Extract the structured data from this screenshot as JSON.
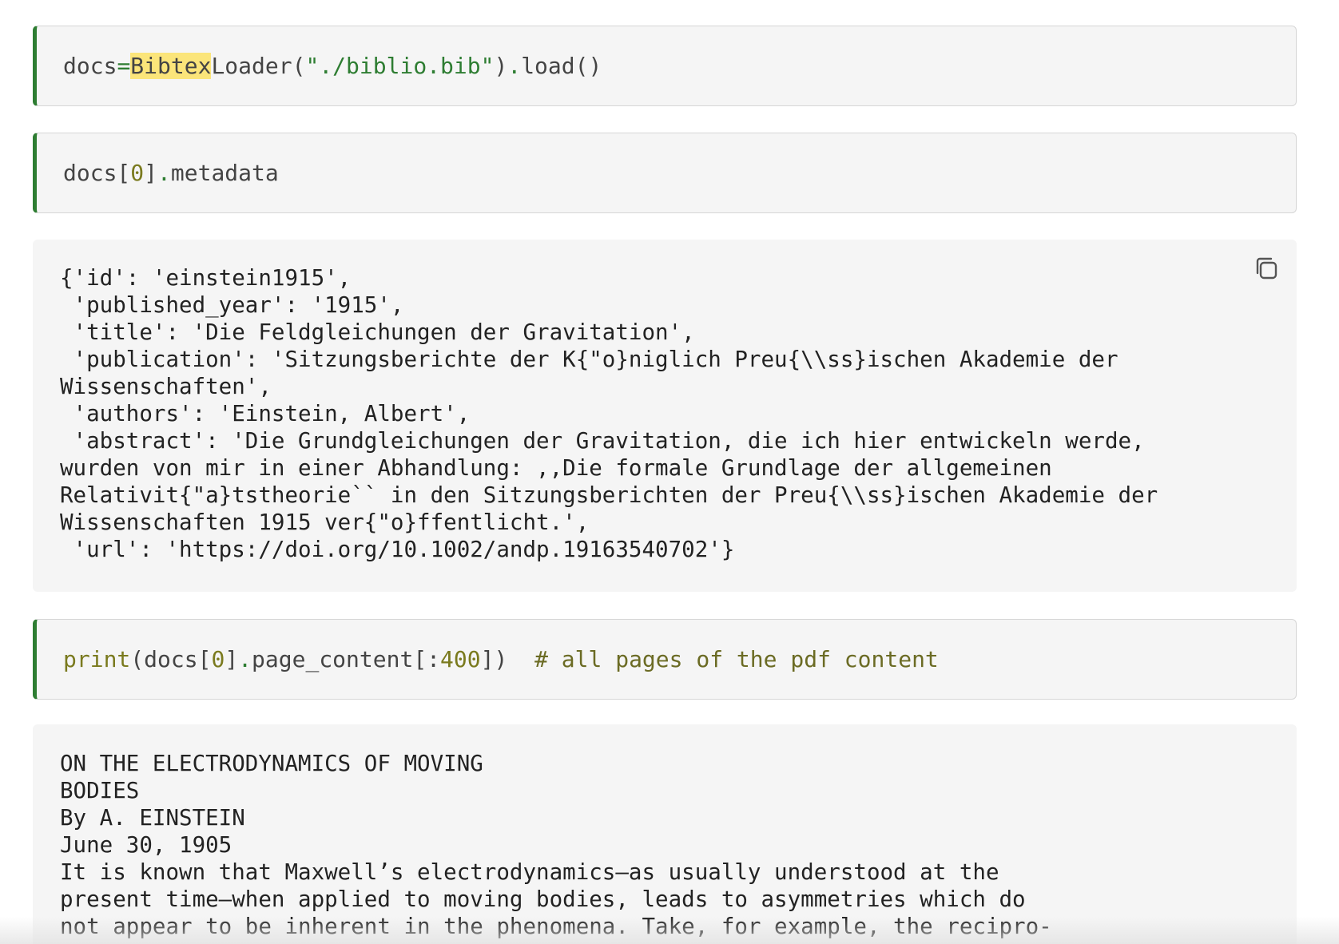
{
  "cells": {
    "cell1": {
      "var": "docs",
      "op": "=",
      "hl": "Bibtex",
      "cls_rest": "Loader(",
      "str": "\"./biblio.bib\"",
      "close": ")",
      "dot": ".",
      "method": "load()"
    },
    "cell2": {
      "var": "docs[",
      "idx": "0",
      "close": "]",
      "dot": ".",
      "attr": "metadata"
    },
    "output1": {
      "lines": [
        "{'id': 'einstein1915',",
        " 'published_year': '1915',",
        " 'title': 'Die Feldgleichungen der Gravitation',",
        " 'publication': 'Sitzungsberichte der K{\"o}niglich Preu{\\\\ss}ischen Akademie der",
        "Wissenschaften',",
        " 'authors': 'Einstein, Albert',",
        " 'abstract': 'Die Grundgleichungen der Gravitation, die ich hier entwickeln werde,",
        "wurden von mir in einer Abhandlung: ,,Die formale Grundlage der allgemeinen",
        "Relativit{\"a}tstheorie`` in den Sitzungsberichten der Preu{\\\\ss}ischen Akademie der",
        "Wissenschaften 1915 ver{\"o}ffentlicht.',",
        " 'url': 'https://doi.org/10.1002/andp.19163540702'}"
      ]
    },
    "cell3": {
      "fn": "print",
      "open": "(docs[",
      "idx": "0",
      "close1": "]",
      "dot": ".",
      "attr": "page_content[:",
      "num": "400",
      "close2": "])",
      "gap": "  ",
      "comment": "# all pages of the pdf content"
    },
    "output2": {
      "lines": [
        "ON THE ELECTRODYNAMICS OF MOVING",
        "BODIES",
        "By A. EINSTEIN",
        "June 30, 1905",
        "It is known that Maxwell’s electrodynamics—as usually understood at the",
        "present time—when applied to moving bodies, leads to asymmetries which do",
        "not appear to be inherent in the phenomena. Take, for example, the recipro-"
      ]
    }
  },
  "icons": {
    "copy": "copy-icon"
  },
  "colors": {
    "accent_green": "#2e7d32",
    "highlight": "#fbe57a",
    "cell_bg": "#f5f5f5",
    "number": "#7a7a1e"
  }
}
